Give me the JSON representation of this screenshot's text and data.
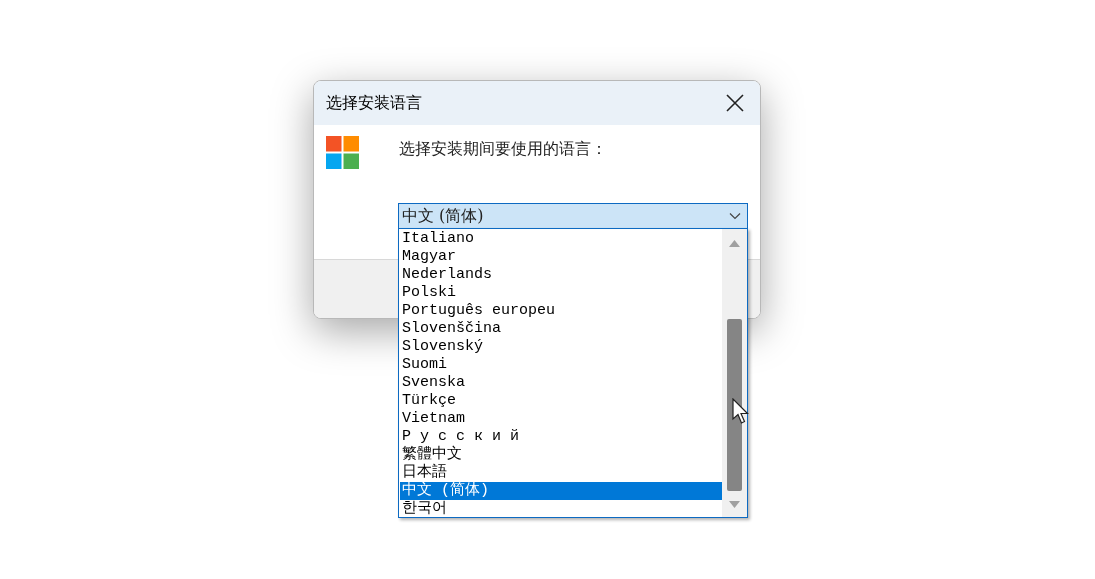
{
  "window": {
    "title": "选择安装语言"
  },
  "prompt": "选择安装期间要使用的语言：",
  "dropdown": {
    "value": "中文 (简体)",
    "expanded": true
  },
  "options": [
    {
      "label": "Italiano",
      "selected": false
    },
    {
      "label": "Magyar",
      "selected": false
    },
    {
      "label": "Nederlands",
      "selected": false
    },
    {
      "label": "Polski",
      "selected": false
    },
    {
      "label": "Português europeu",
      "selected": false
    },
    {
      "label": "Slovenščina",
      "selected": false
    },
    {
      "label": "Slovenský",
      "selected": false
    },
    {
      "label": "Suomi",
      "selected": false
    },
    {
      "label": "Svenska",
      "selected": false
    },
    {
      "label": "Türkçe",
      "selected": false
    },
    {
      "label": "Vietnam",
      "selected": false
    },
    {
      "label": "Р у с с к и й",
      "selected": false
    },
    {
      "label": "繁體中文",
      "selected": false
    },
    {
      "label": "日本語",
      "selected": false
    },
    {
      "label": "中文 (简体)",
      "selected": true
    },
    {
      "label": "한국어",
      "selected": false
    }
  ]
}
